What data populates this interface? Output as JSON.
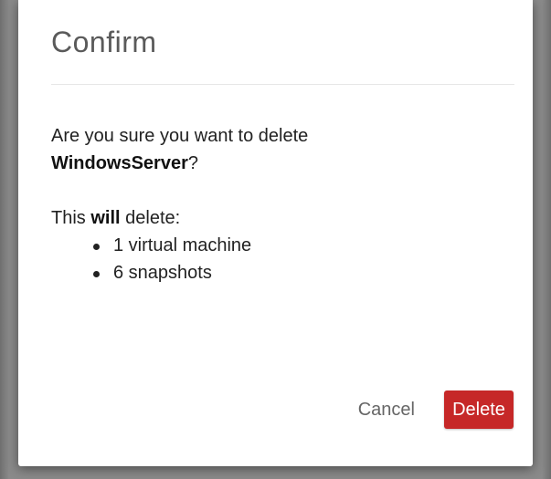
{
  "dialog": {
    "title": "Confirm",
    "question_prefix": "Are you sure you want to delete",
    "target_name": "WindowsServer",
    "question_suffix": "?",
    "summary_prefix": "This",
    "summary_bold": "will",
    "summary_suffix": "delete:",
    "items": [
      "1 virtual machine",
      "6 snapshots"
    ],
    "cancel_label": "Cancel",
    "delete_label": "Delete"
  },
  "colors": {
    "danger": "#c62828",
    "title_text": "#5a5a5a",
    "body_text": "#222222",
    "cancel_text": "#666666"
  }
}
